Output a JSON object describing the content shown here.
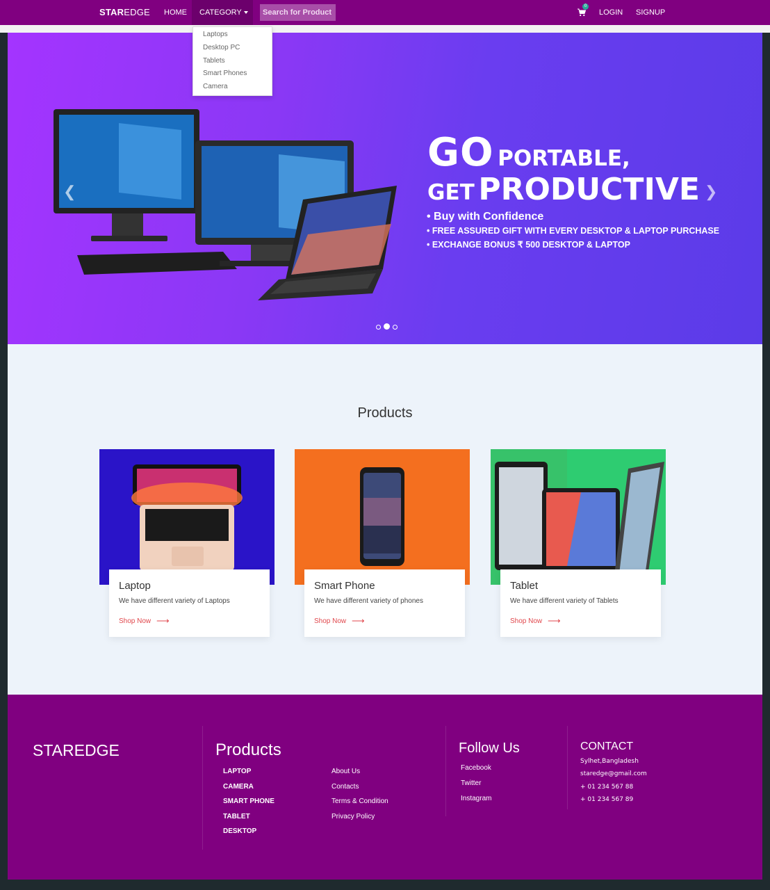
{
  "navbar": {
    "brand_bold": "STAR",
    "brand_rest": "EDGE",
    "home": "HOME",
    "category": "CATEGORY",
    "search_placeholder": "Search for Product",
    "cart_count": "0",
    "login": "LOGIN",
    "signup": "SIGNUP"
  },
  "dropdown": {
    "items": [
      "Laptops",
      "Desktop PC",
      "Tablets",
      "Smart Phones",
      "Camera"
    ]
  },
  "hero": {
    "line1_big": "GO",
    "line1_rest": "PORTABLE,",
    "line2_small": "GET",
    "line2_big": "PRODUCTIVE",
    "bullets": [
      "• Buy with Confidence",
      "• FREE ASSURED GIFT WITH EVERY DESKTOP & LAPTOP PURCHASE",
      "• EXCHANGE BONUS ₹ 500 DESKTOP & LAPTOP"
    ],
    "slides": 3,
    "active_slide": 2
  },
  "products": {
    "title": "Products",
    "cards": [
      {
        "title": "Laptop",
        "desc": "We have different variety of Laptops",
        "link": "Shop Now",
        "bg": "#2a14c8"
      },
      {
        "title": "Smart Phone",
        "desc": "We have different variety of phones",
        "link": "Shop Now",
        "bg": "#f46f1f"
      },
      {
        "title": "Tablet",
        "desc": "We have different variety of Tablets",
        "link": "Shop Now",
        "bg": "#2ecc71"
      }
    ]
  },
  "footer": {
    "brand": "STAREDGE",
    "products_title": "Products",
    "product_links": [
      "LAPTOP",
      "CAMERA",
      "SMART PHONE",
      "TABLET",
      "DESKTOP"
    ],
    "info_links": [
      "About Us",
      "Contacts",
      "Terms & Condition",
      "Privacy Policy"
    ],
    "follow_title": "Follow Us",
    "social": [
      "Facebook",
      "Twitter",
      "Instagram"
    ],
    "contact_title": "CONTACT",
    "contact": [
      "Sylhet,Bangladesh",
      "staredge@gmail.com",
      "+ 01 234 567 88",
      "+ 01 234 567 89"
    ]
  },
  "colors": {
    "brand_purple": "#800080",
    "section_bg": "#edf3fa",
    "accent_red": "#e0474c"
  }
}
